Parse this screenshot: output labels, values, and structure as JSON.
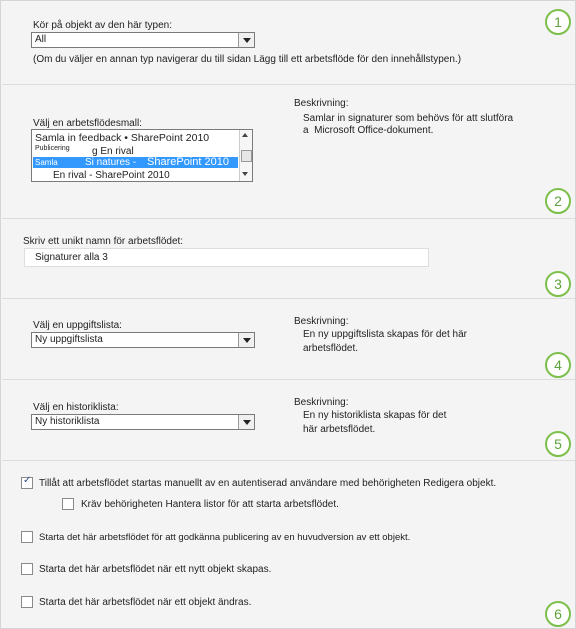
{
  "section1": {
    "label": "Kör på objekt av den här typen:",
    "select_value": "All",
    "note": "(Om du väljer en annan typ navigerar du till sidan Lägg till ett arbetsflöde för den innehållstypen.)",
    "badge": "1"
  },
  "section2": {
    "label": "Välj en arbetsflödesmall:",
    "items": [
      "Samla in feedback • SharePoint 2010",
      "Publicering",
      "g En rival",
      "Samla",
      "Si natures -",
      "SharePoint 2010",
      "En rival - SharePoint 2010"
    ],
    "description_label": "Beskrivning:",
    "description_line1": "Samlar in signaturer som behövs för att slutföra",
    "description_line2": "a  Microsoft Office-dokument.",
    "badge": "2"
  },
  "section3": {
    "label": "Skriv ett unikt namn för arbetsflödet:",
    "input_value": "Signaturer alla 3",
    "badge": "3"
  },
  "section4": {
    "label": "Välj en uppgiftslista:",
    "select_value": "Ny uppgiftslista",
    "description_label": "Beskrivning:",
    "description_line1": "En ny uppgiftslista skapas för det här",
    "description_line2": "arbetsflödet.",
    "badge": "4"
  },
  "section5": {
    "label": "Välj en historiklista:",
    "select_value": "Ny historiklista",
    "description_label": "Beskrivning:",
    "description_line1": "En ny historiklista skapas för det",
    "description_line2": "här arbetsflödet.",
    "badge": "5"
  },
  "section6": {
    "opt_manual": "Tillåt att arbetsflödet startas manuellt av en autentiserad användare med behörigheten Redigera objekt.",
    "opt_manage": "Kräv behörigheten Hantera listor för att starta arbetsflödet.",
    "opt_publish": "Starta det här arbetsflödet för att godkänna publicering av en huvudversion av ett objekt.",
    "opt_create": "Starta det här arbetsflödet när ett nytt objekt skapas.",
    "opt_change": "Starta det här arbetsflödet när ett objekt ändras.",
    "checked_manual": true,
    "badge": "6"
  }
}
